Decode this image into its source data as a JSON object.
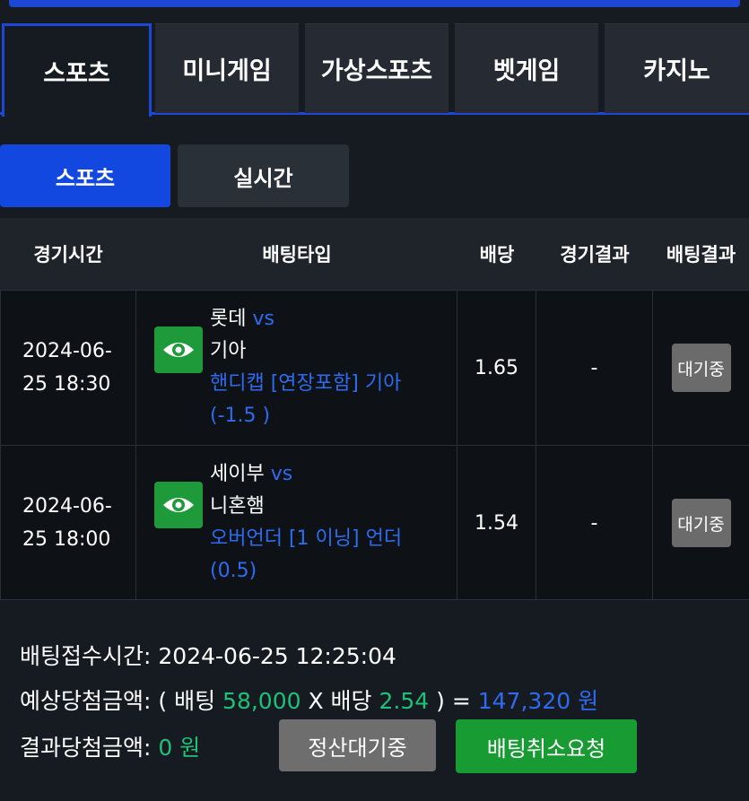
{
  "main_tabs": [
    "스포츠",
    "미니게임",
    "가상스포츠",
    "벳게임",
    "카지노"
  ],
  "sub_tabs": [
    "스포츠",
    "실시간"
  ],
  "table": {
    "headers": [
      "경기시간",
      "배팅타입",
      "배당",
      "경기결과",
      "배팅결과"
    ],
    "rows": [
      {
        "time_line1": "2024-06-",
        "time_line2": "25 18:30",
        "home": "롯데",
        "vs": "vs",
        "away": "기아",
        "bet_line1": "핸디캡 [연장포함] 기아",
        "bet_line2": "(-1.5 )",
        "odds": "1.65",
        "result": "-",
        "status": "대기중"
      },
      {
        "time_line1": "2024-06-",
        "time_line2": "25 18:00",
        "home": "세이부",
        "vs": "vs",
        "away": "니혼햄",
        "bet_line1": "오버언더 [1 이닝] 언더",
        "bet_line2": "(0.5)",
        "odds": "1.54",
        "result": "-",
        "status": "대기중"
      }
    ]
  },
  "summary": {
    "received_label": "배팅접수시간:",
    "received_value": "2024-06-25 12:25:04",
    "expected_label": "예상당첨금액:",
    "expected_open": "( 배팅",
    "bet_amount": "58,000",
    "x_label": "X 배당",
    "total_odds": "2.54",
    "equals": ") =",
    "expected_amount": "147,320 원",
    "result_label": "결과당첨금액:",
    "result_amount": "0 원"
  },
  "buttons": {
    "settle_pending": "정산대기중",
    "cancel_request": "배팅취소요청"
  },
  "colors": {
    "accent_blue": "#1e47d6",
    "link_blue": "#2e6bf0",
    "green": "#1f9a3a",
    "amount_green": "#1fc077"
  }
}
